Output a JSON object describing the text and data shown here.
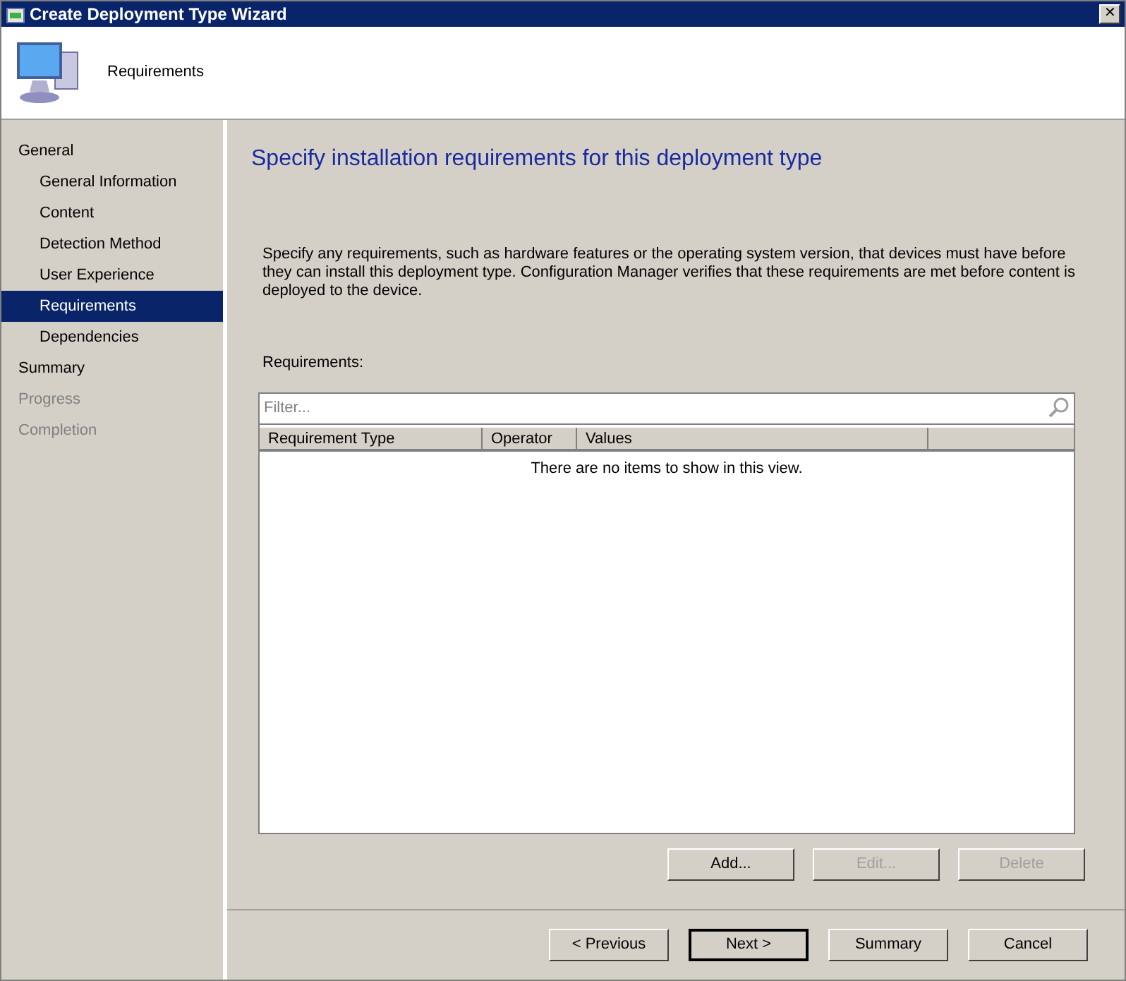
{
  "window": {
    "title": "Create Deployment Type Wizard",
    "close": "✕"
  },
  "header": {
    "title": "Requirements"
  },
  "nav": [
    {
      "label": "General",
      "selected": false,
      "disabled": false,
      "children": [
        {
          "label": "General Information",
          "selected": false,
          "disabled": false
        },
        {
          "label": "Content",
          "selected": false,
          "disabled": false
        },
        {
          "label": "Detection Method",
          "selected": false,
          "disabled": false
        },
        {
          "label": "User Experience",
          "selected": false,
          "disabled": false
        },
        {
          "label": "Requirements",
          "selected": true,
          "disabled": false
        },
        {
          "label": "Dependencies",
          "selected": false,
          "disabled": false
        }
      ]
    },
    {
      "label": "Summary",
      "selected": false,
      "disabled": false
    },
    {
      "label": "Progress",
      "selected": false,
      "disabled": true
    },
    {
      "label": "Completion",
      "selected": false,
      "disabled": true
    }
  ],
  "page": {
    "heading": "Specify installation requirements for this deployment type",
    "description": "Specify any requirements, such as hardware features or the operating system version, that devices must have before they can install this deployment type. Configuration Manager verifies that these requirements are met before content is deployed to the device.",
    "list_label": "Requirements:",
    "filter": {
      "placeholder": "Filter..."
    },
    "table": {
      "columns": [
        "Requirement Type",
        "Operator",
        "Values"
      ],
      "empty_text": "There are no items to show in this view."
    },
    "buttons": [
      {
        "label": "Add...",
        "disabled": false
      },
      {
        "label": "Edit...",
        "disabled": true
      },
      {
        "label": "Delete",
        "disabled": true
      }
    ]
  },
  "footer_buttons": [
    {
      "label": "< Previous",
      "default": false
    },
    {
      "label": "Next >",
      "default": true
    },
    {
      "label": "Summary",
      "default": false
    },
    {
      "label": "Cancel",
      "default": false
    }
  ]
}
